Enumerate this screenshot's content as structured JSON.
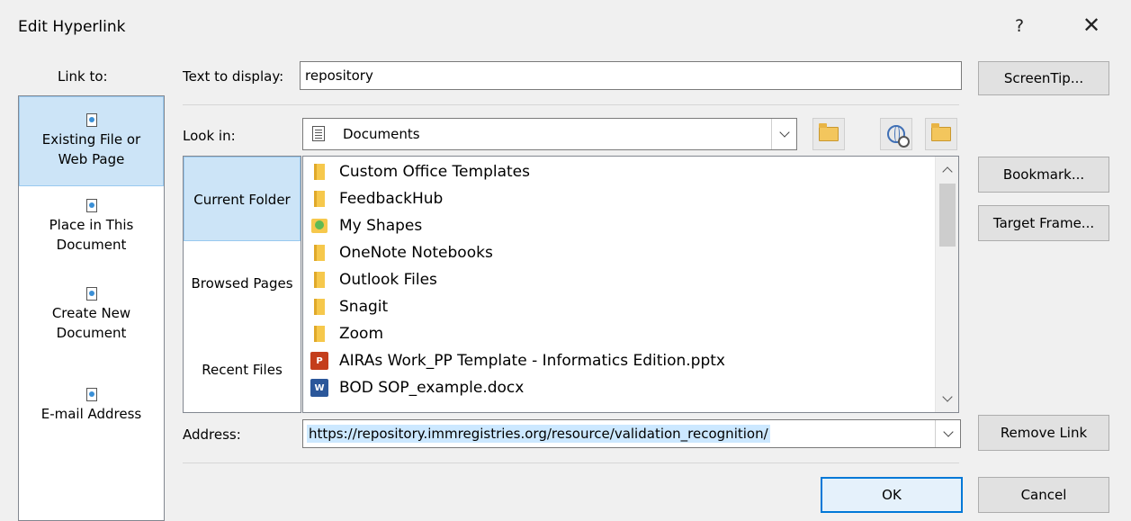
{
  "dialog": {
    "title": "Edit Hyperlink",
    "help_glyph": "?",
    "close_glyph": "✕"
  },
  "link_to": {
    "label": "Link to:",
    "items": [
      {
        "line1": "Existing File or",
        "line2": "Web Page",
        "selected": true
      },
      {
        "line1": "Place in This",
        "line2": "Document",
        "selected": false
      },
      {
        "line1": "Create New",
        "line2": "Document",
        "selected": false
      },
      {
        "line1": "E-mail Address",
        "line2": "",
        "selected": false
      }
    ]
  },
  "text_to_display": {
    "label": "Text to display:",
    "value": "repository"
  },
  "buttons": {
    "screentip": "ScreenTip...",
    "bookmark": "Bookmark...",
    "target_frame": "Target Frame...",
    "remove_link": "Remove Link",
    "ok": "OK",
    "cancel": "Cancel"
  },
  "look_in": {
    "label": "Look in:",
    "value": "Documents"
  },
  "nav": {
    "items": [
      {
        "label": "Current Folder",
        "selected": true
      },
      {
        "label": "Browsed Pages",
        "selected": false
      },
      {
        "label": "Recent Files",
        "selected": false
      }
    ]
  },
  "files": [
    {
      "name": "Custom Office Templates",
      "icon": "folder-icon"
    },
    {
      "name": "FeedbackHub",
      "icon": "folder-icon"
    },
    {
      "name": "My Shapes",
      "icon": "shapes-folder-icon"
    },
    {
      "name": "OneNote Notebooks",
      "icon": "folder-icon"
    },
    {
      "name": "Outlook Files",
      "icon": "folder-icon"
    },
    {
      "name": "Snagit",
      "icon": "folder-icon"
    },
    {
      "name": "Zoom",
      "icon": "folder-icon"
    },
    {
      "name": "AIRAs Work_PP Template - Informatics Edition.pptx",
      "icon": "powerpoint-file-icon"
    },
    {
      "name": "BOD SOP_example.docx",
      "icon": "word-file-icon"
    }
  ],
  "address": {
    "label": "Address:",
    "value": "https://repository.immregistries.org/resource/validation_recognition/"
  }
}
